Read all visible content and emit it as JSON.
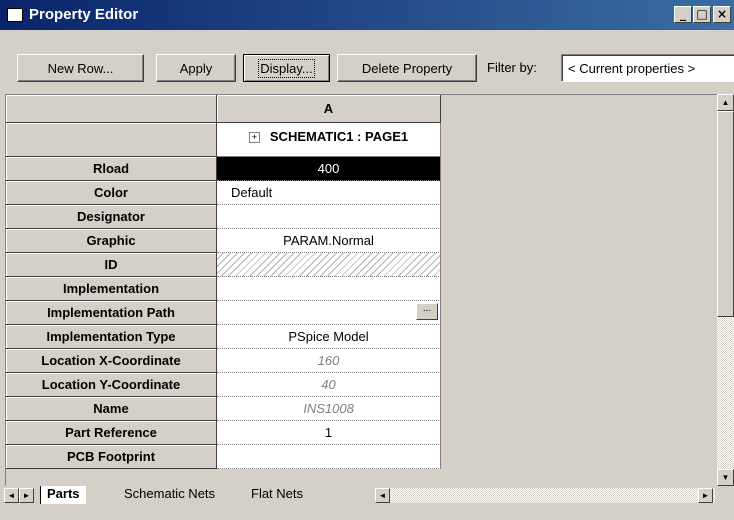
{
  "window": {
    "title": "Property Editor"
  },
  "toolbar": {
    "new_row": "New Row...",
    "apply": "Apply",
    "display": "Display...",
    "delete_property": "Delete Property",
    "filter_label": "Filter by:",
    "filter_value": "< Current properties >"
  },
  "grid": {
    "column_header": "A",
    "group_header": "SCHEMATIC1 : PAGE1",
    "rows": [
      {
        "name": "Rload",
        "value": "400"
      },
      {
        "name": "Color",
        "value": "Default"
      },
      {
        "name": "Designator",
        "value": ""
      },
      {
        "name": "Graphic",
        "value": "PARAM.Normal"
      },
      {
        "name": "ID",
        "value": ""
      },
      {
        "name": "Implementation",
        "value": ""
      },
      {
        "name": "Implementation Path",
        "value": ""
      },
      {
        "name": "Implementation Type",
        "value": "PSpice Model"
      },
      {
        "name": "Location X-Coordinate",
        "value": "160"
      },
      {
        "name": "Location Y-Coordinate",
        "value": "40"
      },
      {
        "name": "Name",
        "value": "INS1008"
      },
      {
        "name": "Part Reference",
        "value": "1"
      },
      {
        "name": "PCB Footprint",
        "value": ""
      }
    ]
  },
  "tabs": [
    "Parts",
    "Schematic Nets",
    "Flat Nets"
  ],
  "colors": {
    "titlebar_start": "#0a246a",
    "titlebar_end": "#3a6ea5",
    "chrome": "#d4d0c8",
    "selected_cell": "#000000"
  },
  "icons": {
    "expand": "plus-icon",
    "minimize": "minimize-icon",
    "maximize": "maximize-icon",
    "close": "close-icon"
  }
}
